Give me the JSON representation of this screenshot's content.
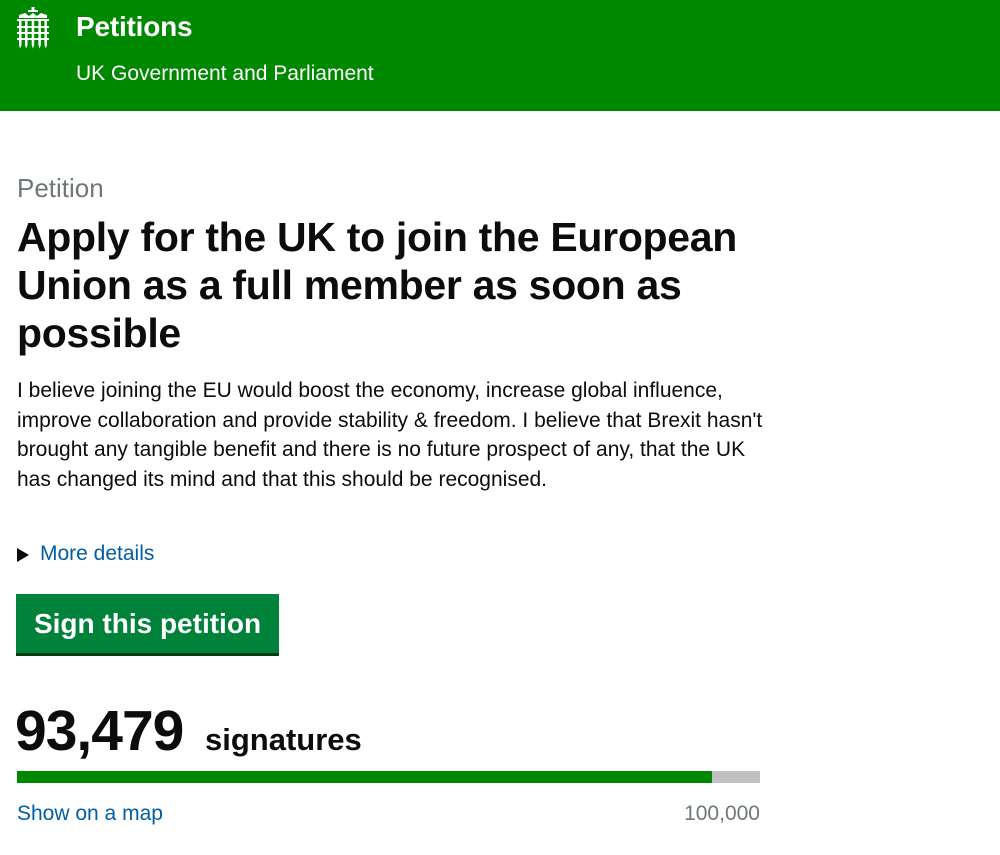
{
  "header": {
    "title": "Petitions",
    "subtitle": "UK Government and Parliament",
    "logo_icon": "portcullis-icon",
    "bg_color": "#008800"
  },
  "petition": {
    "caption": "Petition",
    "title": "Apply for the UK to join the European Union as a full member as soon as possible",
    "description": "I believe joining the EU would boost the economy, increase global influence, improve collaboration and provide stability & freedom. I believe that Brexit hasn't brought any tangible benefit and there is no future prospect of any, that the UK has changed its mind and that this should be recognised.",
    "more_details_label": "More details",
    "sign_button_label": "Sign this petition"
  },
  "signatures": {
    "count": "93,479",
    "label": "signatures",
    "progress_fraction": 0.93479,
    "goal": "100,000",
    "map_link_label": "Show on a map"
  },
  "colors": {
    "brand_green": "#008800",
    "button_green": "#00823b",
    "link_blue": "#005ea5",
    "muted_grey": "#6f777b"
  }
}
